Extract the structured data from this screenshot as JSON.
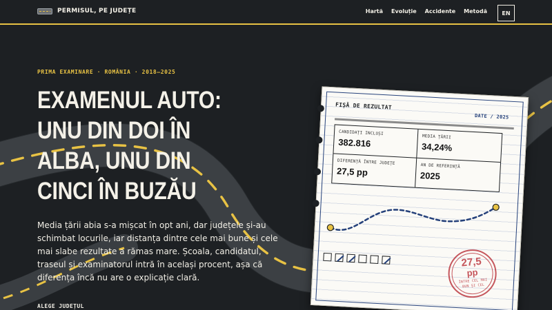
{
  "brand": {
    "name": "PERMISUL, PE JUDEȚE"
  },
  "nav": {
    "items": [
      {
        "label": "Hartă"
      },
      {
        "label": "Evoluție"
      },
      {
        "label": "Accidente"
      },
      {
        "label": "Metodă"
      }
    ],
    "language": "EN"
  },
  "hero": {
    "kicker": "PRIMA EXAMINARE · ROMÂNIA · 2018–2025",
    "headline_lines": [
      "EXAMENUL AUTO:",
      "UNU DIN DOI ÎN",
      "ALBA, UNU DIN",
      "CINCI ÎN BUZĂU"
    ],
    "lead": "Media țării abia s-a mișcat în opt ani, dar județele și-au schimbat locurile, iar distanța dintre cele mai bune și cele mai slabe rezultate a rămas mare. Școala, candidatul, traseul și examinatorul intră în același procent, așa că diferența încă nu are o explicație clară.",
    "county_select_label": "ALEGE JUDEȚUL"
  },
  "card": {
    "title": "FIȘĂ DE REZULTAT",
    "date": "DATE / 2025",
    "stats": [
      {
        "label": "CANDIDAȚI INCLUȘI",
        "value": "382.816"
      },
      {
        "label": "MEDIA ȚĂRII",
        "value": "34,24%"
      },
      {
        "label": "DIFERENȚĂ ÎNTRE JUDEȚE",
        "value": "27,5 pp"
      },
      {
        "label": "AN DE REFERINȚĂ",
        "value": "2025"
      }
    ],
    "checkboxes": [
      false,
      true,
      true,
      false,
      false,
      true
    ],
    "stamp": {
      "value": "27,5",
      "unit": "pp",
      "caption_lines": [
        "ÎNTRE CEL MAI",
        "BUN ȘI CEL"
      ]
    }
  },
  "colors": {
    "background": "#1d2023",
    "accent": "#e8c244",
    "ink_blue": "#24407a",
    "stamp_red": "#c0454c",
    "paper": "#fbfaf6"
  }
}
